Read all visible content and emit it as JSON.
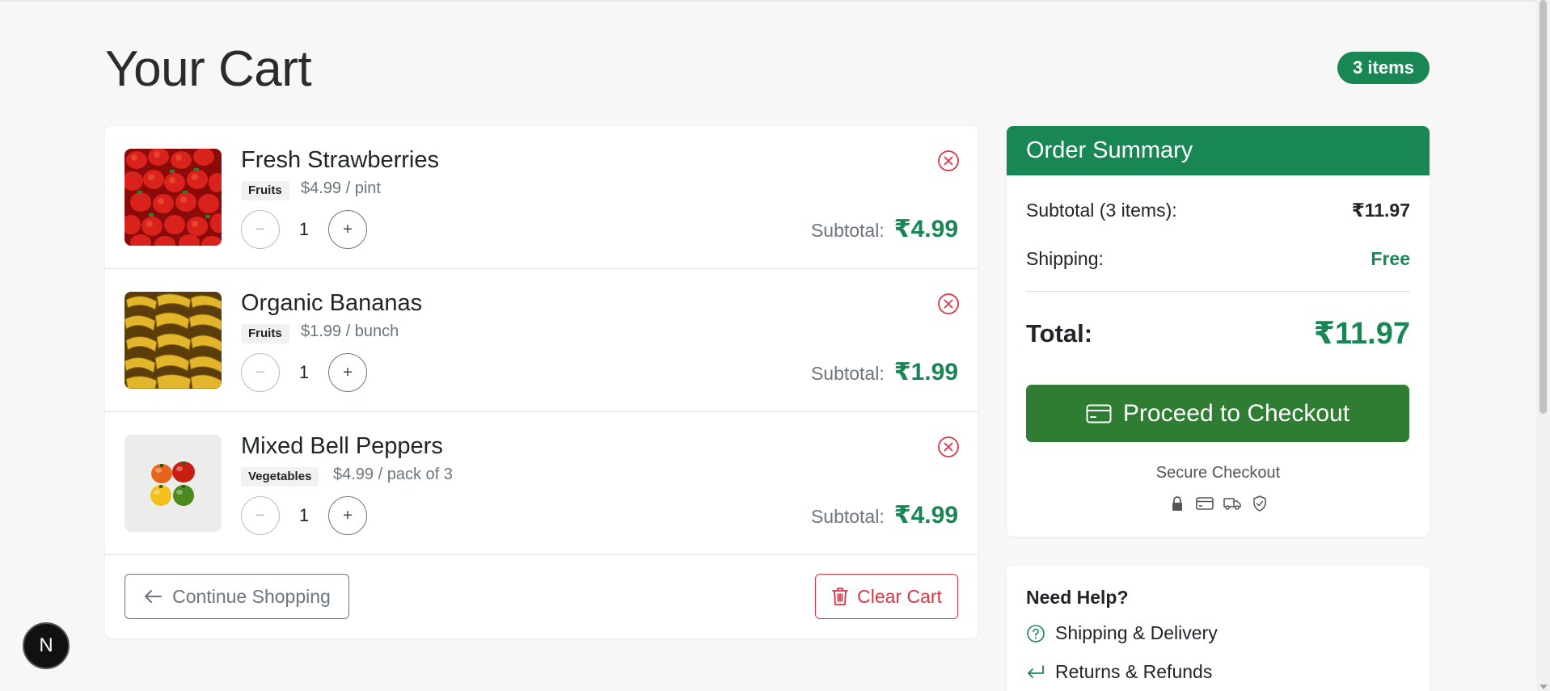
{
  "page": {
    "title": "Your Cart",
    "items_badge": "3 items"
  },
  "cart": {
    "items": [
      {
        "name": "Fresh Strawberries",
        "category": "Fruits",
        "unit_price": "$4.99 / pint",
        "quantity": "1",
        "subtotal_label": "Subtotal:",
        "subtotal": "₹4.99",
        "image": "strawberries"
      },
      {
        "name": "Organic Bananas",
        "category": "Fruits",
        "unit_price": "$1.99 / bunch",
        "quantity": "1",
        "subtotal_label": "Subtotal:",
        "subtotal": "₹1.99",
        "image": "bananas"
      },
      {
        "name": "Mixed Bell Peppers",
        "category": "Vegetables",
        "unit_price": "$4.99 / pack of 3",
        "quantity": "1",
        "subtotal_label": "Subtotal:",
        "subtotal": "₹4.99",
        "image": "bell-peppers"
      }
    ],
    "continue_label": "Continue Shopping",
    "clear_label": "Clear Cart"
  },
  "summary": {
    "header": "Order Summary",
    "subtotal_label": "Subtotal (3 items):",
    "subtotal_value": "₹11.97",
    "shipping_label": "Shipping:",
    "shipping_value": "Free",
    "total_label": "Total:",
    "total_value": "₹11.97",
    "checkout_label": "Proceed to Checkout",
    "secure_label": "Secure Checkout",
    "secure_icons": [
      "lock-icon",
      "credit-card-icon",
      "truck-icon",
      "shield-check-icon"
    ]
  },
  "help": {
    "title": "Need Help?",
    "links": [
      {
        "label": "Shipping & Delivery",
        "icon": "question-circle-icon"
      },
      {
        "label": "Returns & Refunds",
        "icon": "return-arrow-icon"
      }
    ]
  },
  "dev_badge": {
    "label": "N"
  },
  "colors": {
    "primary_green": "#198754",
    "checkout_green": "#2e7d32",
    "danger_red": "#dc3545",
    "muted_gray": "#6c757d"
  }
}
